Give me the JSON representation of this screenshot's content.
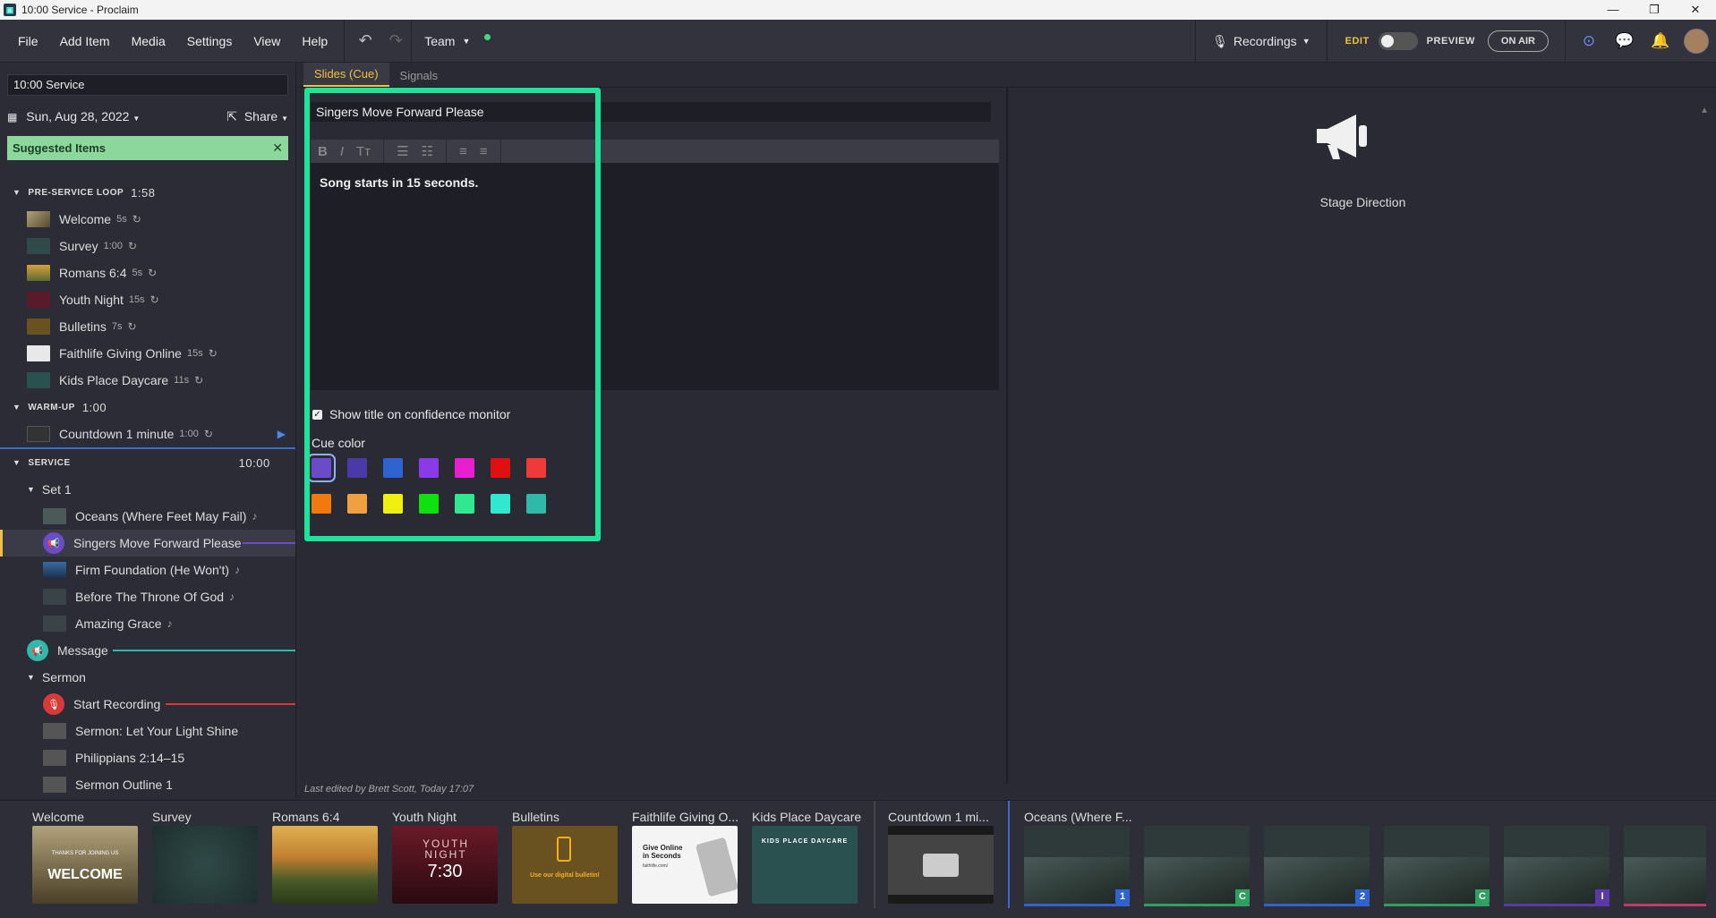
{
  "window": {
    "title": "10:00 Service - Proclaim",
    "minimize": "—",
    "maximize": "❐",
    "close": "✕"
  },
  "menu": {
    "file": "File",
    "add_item": "Add Item",
    "media": "Media",
    "settings": "Settings",
    "view": "View",
    "help": "Help",
    "team": "Team"
  },
  "topright": {
    "recordings": "Recordings",
    "edit": "EDIT",
    "preview": "PREVIEW",
    "on_air": "ON AIR"
  },
  "sidebar": {
    "service_name": "10:00 Service",
    "date": "Sun, Aug 28, 2022",
    "share": "Share",
    "suggested": "Suggested Items",
    "pre_service": {
      "title": "PRE-SERVICE LOOP",
      "duration": "1:58"
    },
    "pre_items": [
      {
        "name": "Welcome",
        "dur": "5s"
      },
      {
        "name": "Survey",
        "dur": "1:00"
      },
      {
        "name": "Romans 6:4",
        "dur": "5s"
      },
      {
        "name": "Youth Night",
        "dur": "15s"
      },
      {
        "name": "Bulletins",
        "dur": "7s"
      },
      {
        "name": "Faithlife Giving Online",
        "dur": "15s"
      },
      {
        "name": "Kids Place Daycare",
        "dur": "11s"
      }
    ],
    "warmup": {
      "title": "WARM-UP",
      "duration": "1:00"
    },
    "warmup_items": [
      {
        "name": "Countdown 1 minute",
        "dur": "1:00"
      }
    ],
    "service": {
      "title": "SERVICE",
      "duration": "10:00"
    },
    "set1": "Set 1",
    "set1_items": [
      "Oceans (Where Feet May Fail)",
      "Singers Move Forward Please",
      "Firm Foundation (He Won't)",
      "Before The Throne Of God",
      "Amazing Grace"
    ],
    "message": "Message",
    "sermon": "Sermon",
    "sermon_items": [
      "Start Recording",
      "Sermon: Let Your Light Shine",
      "Philippians 2:14–15",
      "Sermon Outline 1"
    ]
  },
  "tabs": {
    "slides": "Slides (Cue)",
    "signals": "Signals"
  },
  "editor": {
    "title": "Singers Move Forward Please",
    "body": "Song starts in 15 seconds.",
    "show_title": "Show title on confidence monitor",
    "cue_color": "Cue color",
    "last_edited": "Last edited by Brett Scott, Today 17:07"
  },
  "cue_colors": [
    "#6a4bc8",
    "#4a3aa8",
    "#2f63d0",
    "#8a3ae8",
    "#e81fd0",
    "#e01010",
    "#f03a3a",
    "#f07a10",
    "#f0a040",
    "#f0f010",
    "#10e010",
    "#30e890",
    "#30e8d0",
    "#30b8a8"
  ],
  "stage": {
    "label": "Stage Direction"
  },
  "strip": {
    "pre": [
      "Welcome",
      "Survey",
      "Romans 6:4",
      "Youth Night",
      "Bulletins",
      "Faithlife Giving O...",
      "Kids Place Daycare"
    ],
    "countdown": "Countdown 1 mi...",
    "oceans": "Oceans (Where F...",
    "thumb_text": {
      "welcome_a": "THANKS FOR JOINING US",
      "welcome_b": "WELCOME",
      "youth_a": "YOUTH NIGHT",
      "youth_b": "7:30",
      "bulletin": "Use our digital bulletin!",
      "give_a": "Give Online in Seconds",
      "give_b": "faithlife.com/",
      "kids": "KIDS PLACE DAYCARE"
    },
    "oceans_badges": [
      "1",
      "C",
      "2",
      "C",
      "I"
    ]
  }
}
